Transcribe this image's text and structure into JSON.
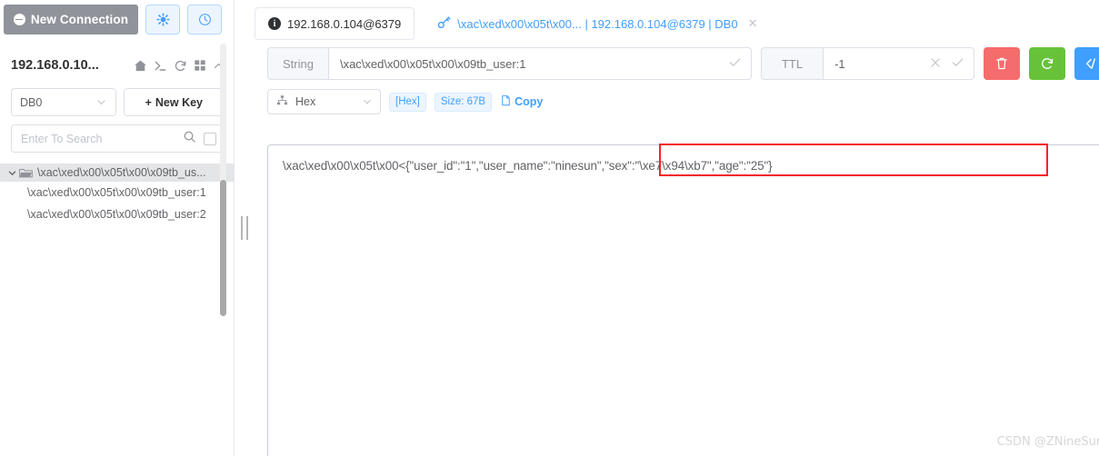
{
  "sidebar": {
    "new_connection_label": "New Connection",
    "toolbar_icons": [
      {
        "name": "settings-icon",
        "glyph": "⚙"
      },
      {
        "name": "history-clock-icon",
        "glyph": "◴"
      }
    ],
    "connection_title": "192.168.0.10...",
    "header_icons": [
      {
        "name": "home-icon"
      },
      {
        "name": "terminal-icon"
      },
      {
        "name": "refresh-icon"
      },
      {
        "name": "grid-icon"
      },
      {
        "name": "chevron-up-icon"
      }
    ],
    "db_select_value": "DB0",
    "new_key_label": "New Key",
    "search_placeholder": "Enter To Search",
    "search_value": "",
    "tree": {
      "folder_label": "\\xac\\xed\\x00\\x05t\\x00\\x09tb_us...",
      "children": [
        "\\xac\\xed\\x00\\x05t\\x00\\x09tb_user:1",
        "\\xac\\xed\\x00\\x05t\\x00\\x09tb_user:2"
      ]
    }
  },
  "tabs": [
    {
      "label": "192.168.0.104@6379",
      "icon": "info-icon",
      "active": false,
      "closable": false
    },
    {
      "label": "\\xac\\xed\\x00\\x05t\\x00... | 192.168.0.104@6379 | DB0",
      "icon": "key-icon",
      "active": true,
      "closable": true
    }
  ],
  "key_editor": {
    "type_label": "String",
    "key_value": "\\xac\\xed\\x00\\x05t\\x00\\x09tb_user:1",
    "ttl_label": "TTL",
    "ttl_value": "-1",
    "actions": [
      {
        "name": "delete-key-button",
        "icon": "trash-icon",
        "color": "#f56c6c"
      },
      {
        "name": "reload-key-button",
        "icon": "refresh-icon",
        "color": "#67c23a"
      },
      {
        "name": "code-view-button",
        "icon": "code-icon",
        "color": "#409eff"
      }
    ]
  },
  "format_bar": {
    "view_format": "Hex",
    "format_badge": "[Hex]",
    "size_badge": "Size: 67B",
    "copy_label": "Copy"
  },
  "value_content": "\\xac\\xed\\x00\\x05t\\x00<{\"user_id\":\"1\",\"user_name\":\"ninesun\",\"sex\":\"\\xe7\\x94\\xb7\",\"age\":\"25\"}",
  "watermark": "CSDN @ZNineSun",
  "colors": {
    "accent_blue": "#409eff",
    "danger_red": "#f56c6c",
    "success_green": "#67c23a",
    "highlight_box_red": "#f5222d",
    "new_connection_gray": "#909399"
  }
}
